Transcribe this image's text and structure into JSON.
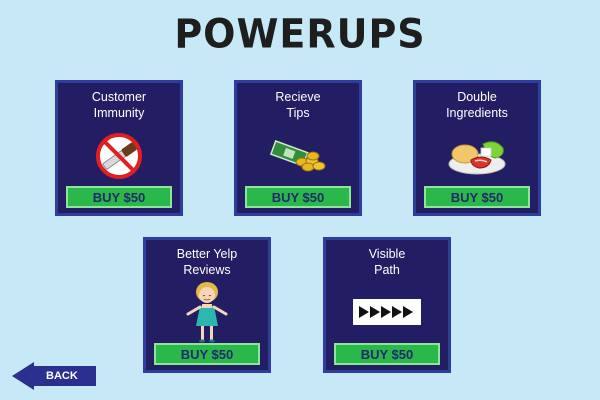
{
  "title": "POWERUPS",
  "powerups": [
    {
      "line1": "Customer",
      "line2": "Immunity",
      "buy_label": "BUY $50",
      "icon": "no-knife-icon"
    },
    {
      "line1": "Recieve",
      "line2": "Tips",
      "buy_label": "BUY $50",
      "icon": "money-coins-icon"
    },
    {
      "line1": "Double",
      "line2": "Ingredients",
      "buy_label": "BUY $50",
      "icon": "ingredients-icon"
    },
    {
      "line1": "Better Yelp",
      "line2": "Reviews",
      "buy_label": "BUY $50",
      "icon": "happy-customer-icon"
    },
    {
      "line1": "Visible",
      "line2": "Path",
      "buy_label": "BUY $50",
      "icon": "path-arrows-icon"
    }
  ],
  "back_label": "BACK",
  "colors": {
    "background": "#c6e8f7",
    "card": "#231d63",
    "card_border": "#2f3e9e",
    "buy_button": "#2bb84a",
    "buy_text": "#1f2a6e"
  }
}
